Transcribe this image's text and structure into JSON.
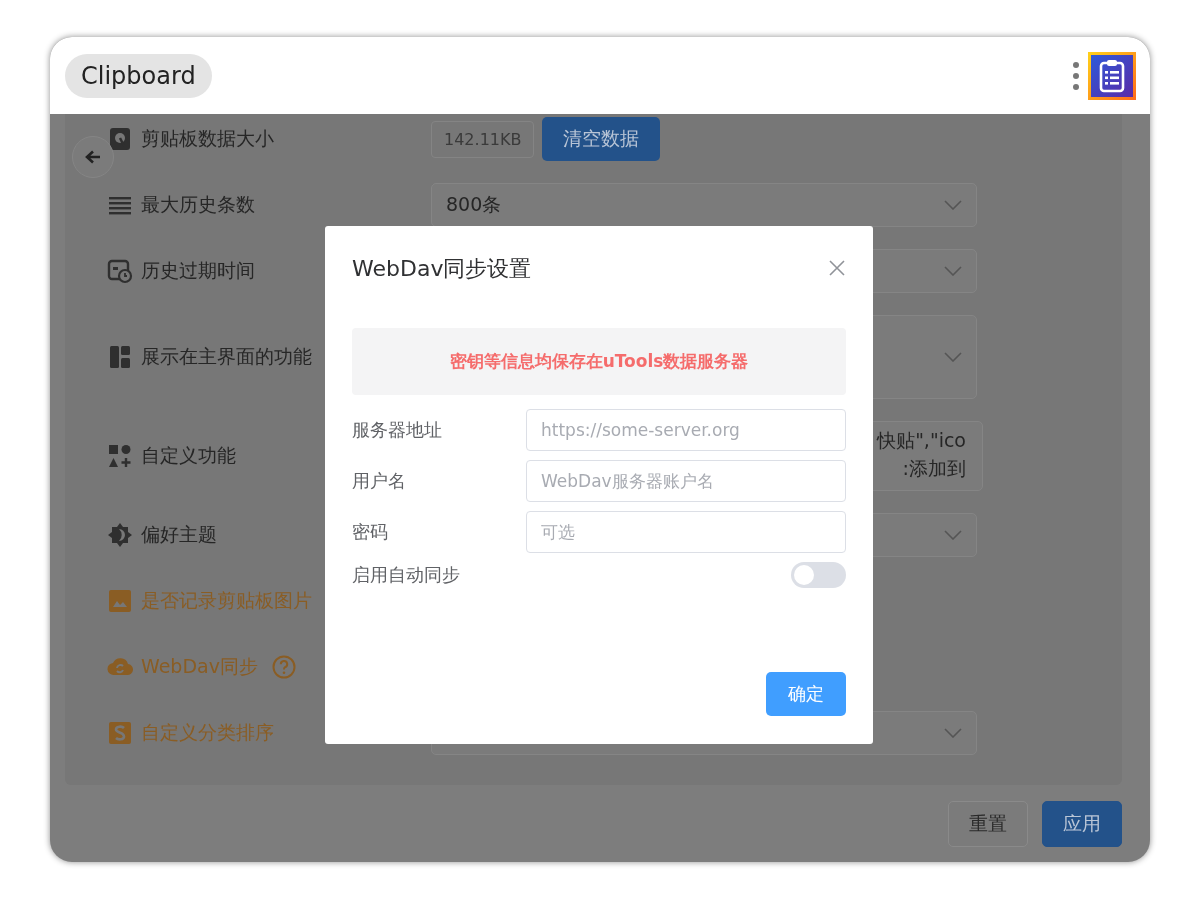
{
  "header": {
    "title": "Clipboard"
  },
  "settings": [
    {
      "label": "剪贴板数据大小",
      "accent": false,
      "control": {
        "kind": "size",
        "value": "142.11KB",
        "button": "清空数据"
      }
    },
    {
      "label": "最大历史条数",
      "accent": false,
      "control": {
        "kind": "select",
        "value": "800条"
      }
    },
    {
      "label": "历史过期时间",
      "accent": false,
      "control": {
        "kind": "select"
      }
    },
    {
      "label": "展示在主界面的功能",
      "accent": false,
      "control": {
        "kind": "tall-select"
      }
    },
    {
      "label": "自定义功能",
      "accent": false,
      "control": {
        "kind": "textarea",
        "lines": [
          "快贴\",\"ico",
          ":添加到"
        ]
      }
    },
    {
      "label": "偏好主题",
      "accent": false,
      "control": {
        "kind": "select"
      }
    },
    {
      "label": "是否记录剪贴板图片",
      "accent": true
    },
    {
      "label": "WebDav同步",
      "accent": true,
      "help": true
    },
    {
      "label": "自定义分类排序",
      "accent": true,
      "control": {
        "kind": "select"
      }
    }
  ],
  "footer": {
    "buttons": [
      {
        "label": "重置",
        "primary": false
      },
      {
        "label": "应用",
        "primary": true
      }
    ]
  },
  "dialog": {
    "title": "WebDav同步设置",
    "notice": "密钥等信息均保存在uTools数据服务器",
    "fields": [
      {
        "label": "服务器地址",
        "placeholder": "https://some-server.org"
      },
      {
        "label": "用户名",
        "placeholder": "WebDav服务器账户名"
      },
      {
        "label": "密码",
        "placeholder": "可选"
      }
    ],
    "auto_sync": {
      "label": "启用自动同步",
      "on": false
    },
    "confirm": "确定"
  }
}
